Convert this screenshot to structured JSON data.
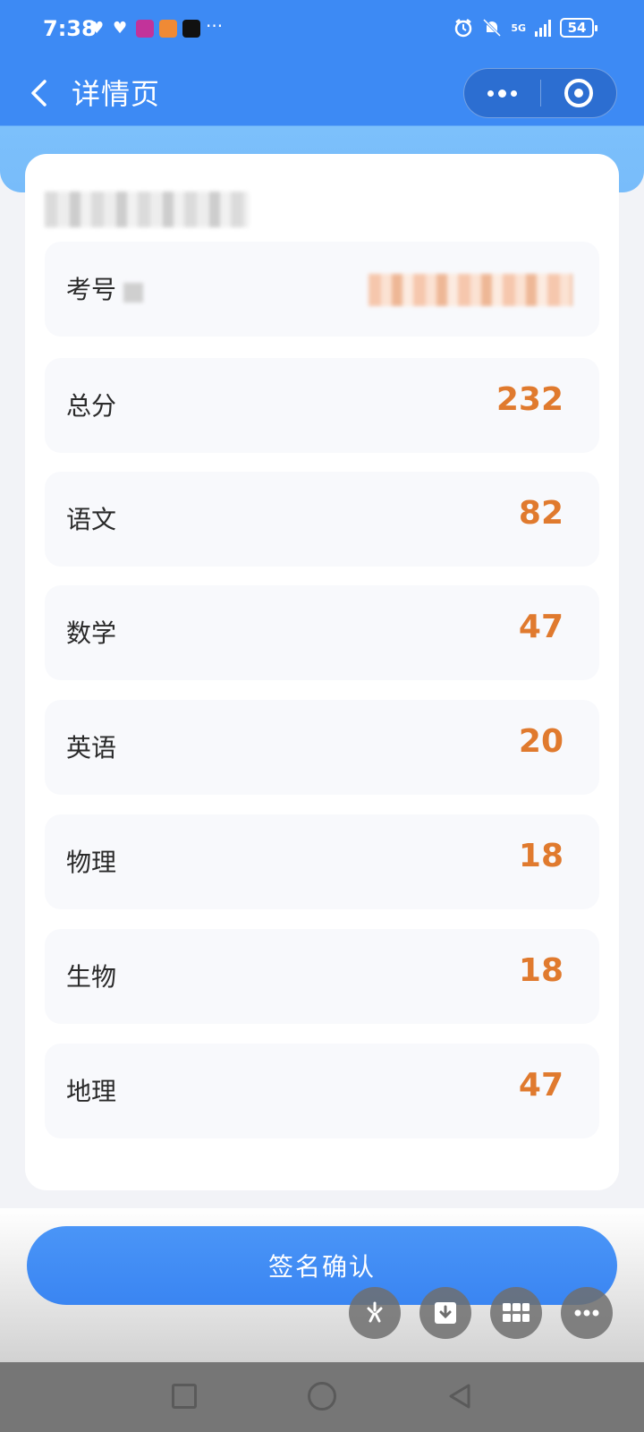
{
  "status_bar": {
    "time": "7:38",
    "network": "5G",
    "battery": "54"
  },
  "nav": {
    "title": "详情页"
  },
  "card": {
    "exam_number": {
      "label": "考号",
      "label_visible": "考号"
    },
    "scores": [
      {
        "label": "总分",
        "value": "232"
      },
      {
        "label": "语文",
        "value": "82"
      },
      {
        "label": "数学",
        "value": "47"
      },
      {
        "label": "英语",
        "value": "20"
      },
      {
        "label": "物理",
        "value": "18"
      },
      {
        "label": "生物",
        "value": "18"
      },
      {
        "label": "地理",
        "value": "47"
      }
    ]
  },
  "confirm_button": {
    "label": "签名确认"
  },
  "colors": {
    "primary": "#3d8af4",
    "score": "#e07a2e",
    "row_bg": "#f8f9fc"
  },
  "icons": [
    "back-chevron-icon",
    "more-dots-icon",
    "close-target-icon",
    "sparkle-icon",
    "download-icon",
    "grid-icon",
    "more-icon"
  ]
}
